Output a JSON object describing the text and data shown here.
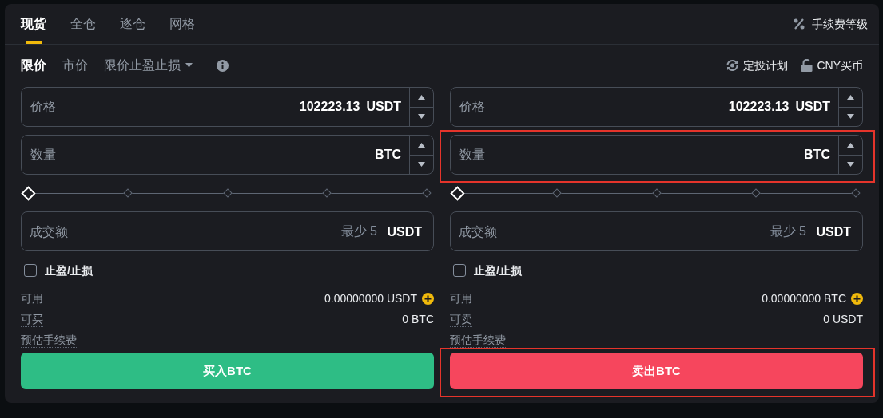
{
  "tabs": [
    {
      "label": "现货",
      "selected": true
    },
    {
      "label": "全仓",
      "selected": false
    },
    {
      "label": "逐仓",
      "selected": false
    },
    {
      "label": "网格",
      "selected": false
    }
  ],
  "fee_level": {
    "label": "手续费等级"
  },
  "order_types": [
    {
      "label": "限价",
      "selected": true,
      "dropdown": false
    },
    {
      "label": "市价",
      "selected": false,
      "dropdown": false
    },
    {
      "label": "限价止盈止损",
      "selected": false,
      "dropdown": true
    }
  ],
  "links": [
    {
      "kind": "recurring",
      "label": "定投计划"
    },
    {
      "kind": "lock",
      "label": "CNY买币"
    }
  ],
  "columns": [
    {
      "kind": "buy",
      "price": {
        "label": "价格",
        "value": "102223.13",
        "unit": "USDT",
        "highlighted": false
      },
      "quantity": {
        "label": "数量",
        "unit": "BTC",
        "highlighted": false
      },
      "slider": {
        "level": 0
      },
      "total": {
        "label": "成交额",
        "placeholder": "最少 5",
        "unit": "USDT"
      },
      "tpsl": {
        "label": "止盈/止损",
        "checked": false
      },
      "info": [
        {
          "label": "可用",
          "value": "0.00000000 USDT",
          "add": true
        },
        {
          "label": "可买",
          "value": "0 BTC",
          "add": false
        },
        {
          "label": "预估手续费",
          "add": false
        }
      ],
      "submit": {
        "label": "买入BTC",
        "highlighted": false
      }
    },
    {
      "kind": "sell",
      "price": {
        "label": "价格",
        "value": "102223.13",
        "unit": "USDT",
        "highlighted": false
      },
      "quantity": {
        "label": "数量",
        "unit": "BTC",
        "highlighted": true
      },
      "slider": {
        "level": 0
      },
      "total": {
        "label": "成交额",
        "placeholder": "最少 5",
        "unit": "USDT"
      },
      "tpsl": {
        "label": "止盈/止损",
        "checked": false
      },
      "info": [
        {
          "label": "可用",
          "value": "0.00000000 BTC",
          "add": true
        },
        {
          "label": "可卖",
          "value": "0 USDT",
          "add": false
        },
        {
          "label": "预估手续费",
          "add": false
        }
      ],
      "submit": {
        "label": "卖出BTC",
        "highlighted": true
      }
    }
  ]
}
